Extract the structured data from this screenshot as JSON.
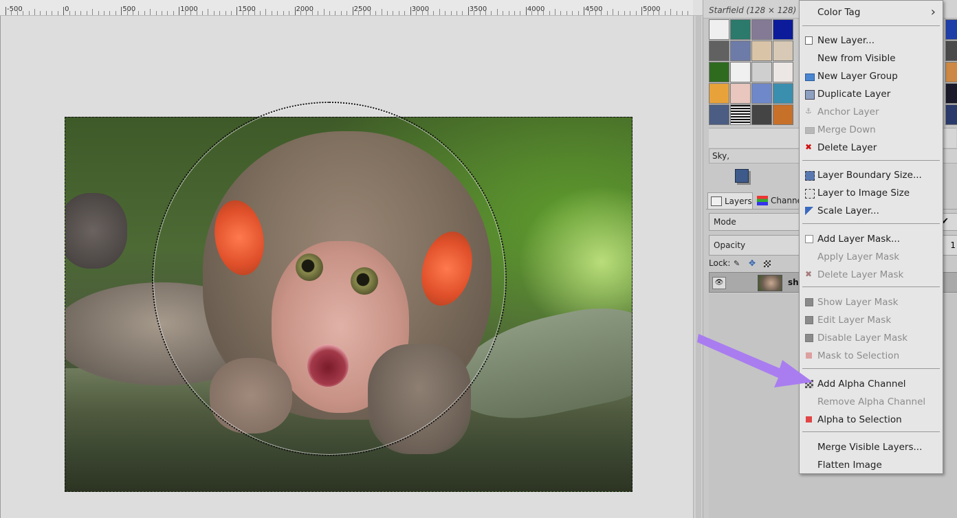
{
  "ruler": {
    "labels": [
      "-500",
      "0",
      "500",
      "1000",
      "1500",
      "2000",
      "2500",
      "3000",
      "3500",
      "4000",
      "4500",
      "5000"
    ]
  },
  "patterns": {
    "title": "Starfield (128 × 128)",
    "swatch_colors": [
      "#efefef",
      "#2b7a6b",
      "#857a96",
      "#0b1b9a",
      "#616161",
      "#6d7ba8",
      "#d9c4a8",
      "#d7c9b5",
      "#2f6b1f",
      "#f0f0f0",
      "#cfcfcf",
      "#ece7e4",
      "#e8a23a",
      "#e9c7bf",
      "#6f88c9",
      "#3a8fae",
      "#4b5d82",
      "#2a2a2a",
      "#444444",
      "#c7702a"
    ],
    "right_colors": [
      "#1f3fa8",
      "#4a4a4a",
      "#cc8844",
      "#1a1a2a",
      "#2a3a6a"
    ]
  },
  "brush_name": "Sky,",
  "layers_panel": {
    "tabs": [
      {
        "label": "Layers"
      },
      {
        "label": "Channe"
      }
    ],
    "mode_label": "Mode",
    "opacity_label": "Opacity",
    "opacity_value": "1",
    "lock_label": "Lock:",
    "layer_name": "sho"
  },
  "context_menu": {
    "items": [
      {
        "label": "Color Tag",
        "disabled": false,
        "submenu": true,
        "icon": ""
      },
      {
        "label": "New Layer...",
        "disabled": false,
        "icon": "new-layer-icon"
      },
      {
        "label": "New from Visible",
        "disabled": false,
        "icon": ""
      },
      {
        "label": "New Layer Group",
        "disabled": false,
        "icon": "new-layer-group-icon"
      },
      {
        "label": "Duplicate Layer",
        "disabled": false,
        "icon": "duplicate-layer-icon"
      },
      {
        "label": "Anchor Layer",
        "disabled": true,
        "icon": "anchor-icon"
      },
      {
        "label": "Merge Down",
        "disabled": true,
        "icon": "merge-down-icon"
      },
      {
        "label": "Delete Layer",
        "disabled": false,
        "icon": "delete-icon"
      },
      {
        "label": "Layer Boundary Size...",
        "disabled": false,
        "icon": "layer-boundary-icon"
      },
      {
        "label": "Layer to Image Size",
        "disabled": false,
        "icon": "layer-to-image-icon"
      },
      {
        "label": "Scale Layer...",
        "disabled": false,
        "icon": "scale-layer-icon"
      },
      {
        "label": "Add Layer Mask...",
        "disabled": false,
        "icon": "add-mask-icon"
      },
      {
        "label": "Apply Layer Mask",
        "disabled": true,
        "icon": ""
      },
      {
        "label": "Delete Layer Mask",
        "disabled": true,
        "icon": "delete-mask-icon"
      },
      {
        "label": "Show Layer Mask",
        "disabled": true,
        "icon": "checkbox-icon"
      },
      {
        "label": "Edit Layer Mask",
        "disabled": true,
        "icon": "checkbox-icon"
      },
      {
        "label": "Disable Layer Mask",
        "disabled": true,
        "icon": "checkbox-icon"
      },
      {
        "label": "Mask to Selection",
        "disabled": true,
        "icon": "mask-selection-icon"
      },
      {
        "label": "Add Alpha Channel",
        "disabled": false,
        "icon": "alpha-channel-icon"
      },
      {
        "label": "Remove Alpha Channel",
        "disabled": true,
        "icon": ""
      },
      {
        "label": "Alpha to Selection",
        "disabled": false,
        "icon": "alpha-selection-icon"
      },
      {
        "label": "Merge Visible Layers...",
        "disabled": false,
        "icon": ""
      },
      {
        "label": "Flatten Image",
        "disabled": false,
        "icon": ""
      }
    ]
  },
  "colors": {
    "arrow": "#a97df0",
    "delete_red": "#d01010",
    "alpha_red": "#e04646"
  }
}
